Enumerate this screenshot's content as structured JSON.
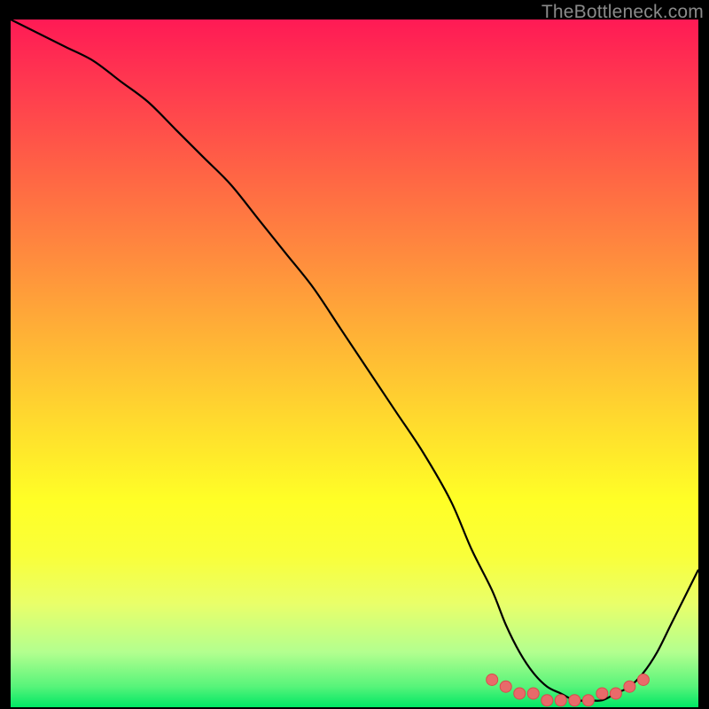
{
  "watermark": "TheBottleneck.com",
  "colors": {
    "page_bg": "#000000",
    "curve_stroke": "#000000",
    "dot_fill": "#e86a6a",
    "dot_stroke": "#d84c4c"
  },
  "chart_data": {
    "type": "line",
    "title": "",
    "xlabel": "",
    "ylabel": "",
    "xlim": [
      0,
      100
    ],
    "ylim": [
      0,
      100
    ],
    "grid": false,
    "legend": false,
    "background": "rainbow-vertical-gradient",
    "series": [
      {
        "name": "bottleneck-curve",
        "x": [
          0,
          4,
          8,
          12,
          16,
          20,
          24,
          28,
          32,
          36,
          40,
          44,
          48,
          52,
          56,
          60,
          64,
          67,
          70,
          72,
          74,
          76,
          78,
          80,
          82,
          84,
          86,
          88,
          90,
          92,
          94,
          96,
          98,
          100
        ],
        "y": [
          100,
          98,
          96,
          94,
          91,
          88,
          84,
          80,
          76,
          71,
          66,
          61,
          55,
          49,
          43,
          37,
          30,
          23,
          17,
          12,
          8,
          5,
          3,
          2,
          1,
          1,
          1,
          2,
          3,
          5,
          8,
          12,
          16,
          20
        ]
      }
    ],
    "highlight_dots": {
      "name": "flat-region-markers",
      "x": [
        70,
        72,
        74,
        76,
        78,
        80,
        82,
        84,
        86,
        88,
        90,
        92
      ],
      "y": [
        4,
        3,
        2,
        2,
        1,
        1,
        1,
        1,
        2,
        2,
        3,
        4
      ]
    }
  }
}
